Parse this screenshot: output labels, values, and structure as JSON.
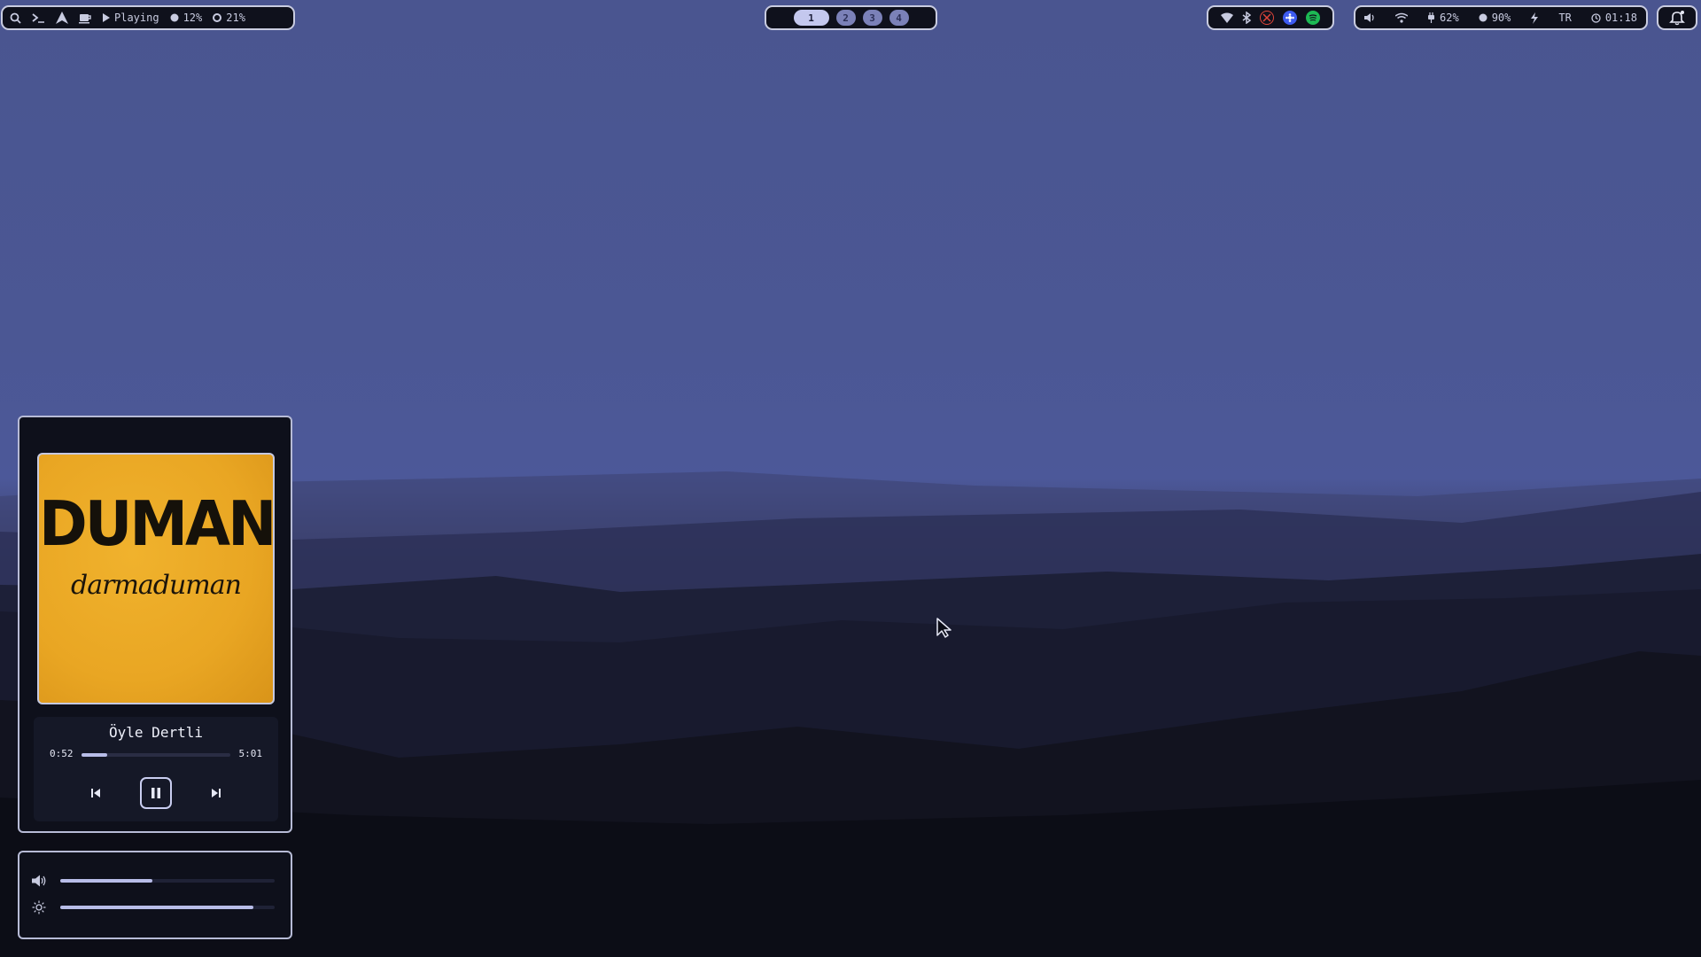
{
  "topbar": {
    "left": {
      "search_icon": "search-icon",
      "terminal_icon": "terminal-icon",
      "launcher_icon": "arch-icon",
      "coffee_icon": "coffee-icon",
      "media_status": "Playing",
      "cpu": "12%",
      "memory": "21%"
    },
    "workspaces": [
      "1",
      "2",
      "3",
      "4"
    ],
    "active_workspace": "1",
    "tray": [
      "wifi-icon",
      "bluetooth-icon",
      "xrandr-icon",
      "flower-icon",
      "spotify-icon"
    ],
    "status": {
      "volume_icon": "volume-icon",
      "network_icon": "wifi-icon",
      "battery": "62%",
      "brightness": "90%",
      "power_icon": "lightning-icon",
      "keyboard_layout": "TR",
      "clock": "01:18"
    },
    "notification_icon": "bell-icon"
  },
  "media": {
    "album_artist": "DUMAN",
    "album_title": "darmaduman",
    "track": "Öyle Dertli",
    "elapsed": "0:52",
    "total": "5:01",
    "progress": 0.17,
    "is_playing": true
  },
  "sliders": {
    "volume": 0.43,
    "brightness": 0.9
  },
  "colors": {
    "accent": "#b8bde8",
    "panel_bg": "#0e101b",
    "border": "#c9cce0",
    "spotify": "#1db954",
    "album_bg": "#e9a623"
  }
}
